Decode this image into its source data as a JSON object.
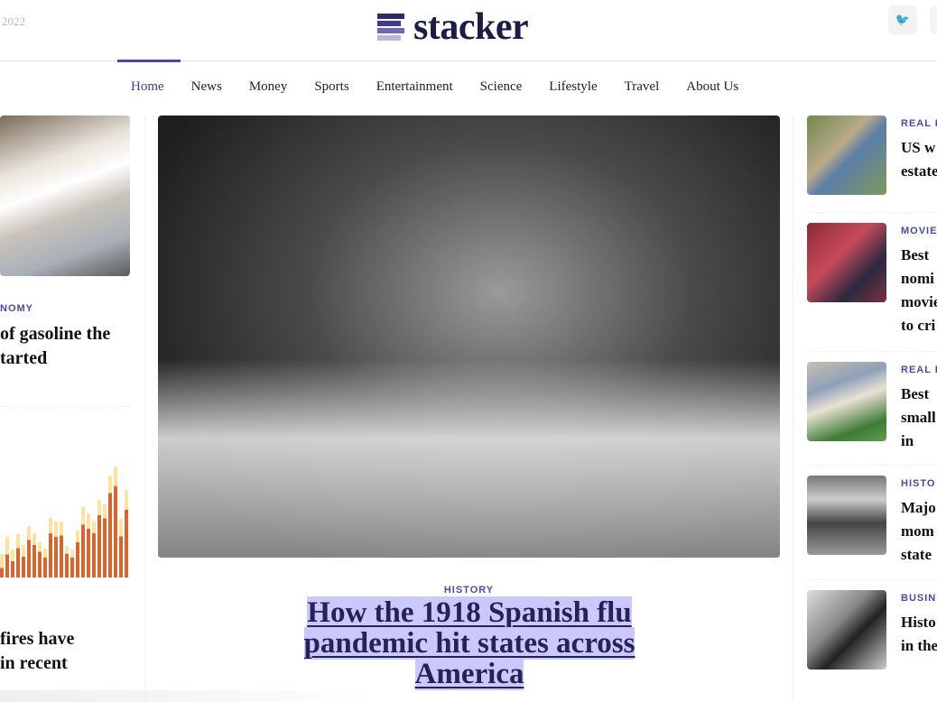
{
  "header": {
    "date_fragment": "2022",
    "logo_text": "stacker",
    "logo_colors": [
      "#2d2b6b",
      "#3d3a9e",
      "#6a67bd",
      "#b9b6e0"
    ],
    "social": [
      {
        "icon": "twitter-icon",
        "glyph": "🐦"
      }
    ]
  },
  "nav": {
    "items": [
      {
        "label": "Home",
        "active": true
      },
      {
        "label": "News"
      },
      {
        "label": "Money"
      },
      {
        "label": "Sports"
      },
      {
        "label": "Entertainment"
      },
      {
        "label": "Science"
      },
      {
        "label": "Lifestyle"
      },
      {
        "label": "Travel"
      },
      {
        "label": "About Us"
      }
    ]
  },
  "left": {
    "story1": {
      "category": "NOMY",
      "title_lines": [
        "of gasoline the",
        "tarted"
      ]
    },
    "story2": {
      "title_lines": [
        "fires have",
        "in recent"
      ]
    }
  },
  "main": {
    "category": "HISTORY",
    "headline_lines": [
      "How the 1918 Spanish flu",
      "pandemic hit states across",
      "America"
    ]
  },
  "right": [
    {
      "category": "REAL E",
      "title_lines": [
        "US w",
        "estate"
      ]
    },
    {
      "category": "MOVIE",
      "title_lines": [
        "Best",
        "nomi",
        "movie",
        "to cri"
      ]
    },
    {
      "category": "REAL E",
      "title_lines": [
        "Best",
        "small",
        "in"
      ]
    },
    {
      "category": "HISTO",
      "title_lines": [
        "Majo",
        "mom",
        "state"
      ]
    },
    {
      "category": "BUSIN",
      "title_lines": [
        "Histo",
        "in the"
      ]
    }
  ],
  "colors": {
    "accent": "#4a47b0",
    "headline": "#24225a",
    "selection": "#cbc8fb",
    "chart_bar": "#d9652e",
    "chart_bar_light": "#fde3a0"
  }
}
